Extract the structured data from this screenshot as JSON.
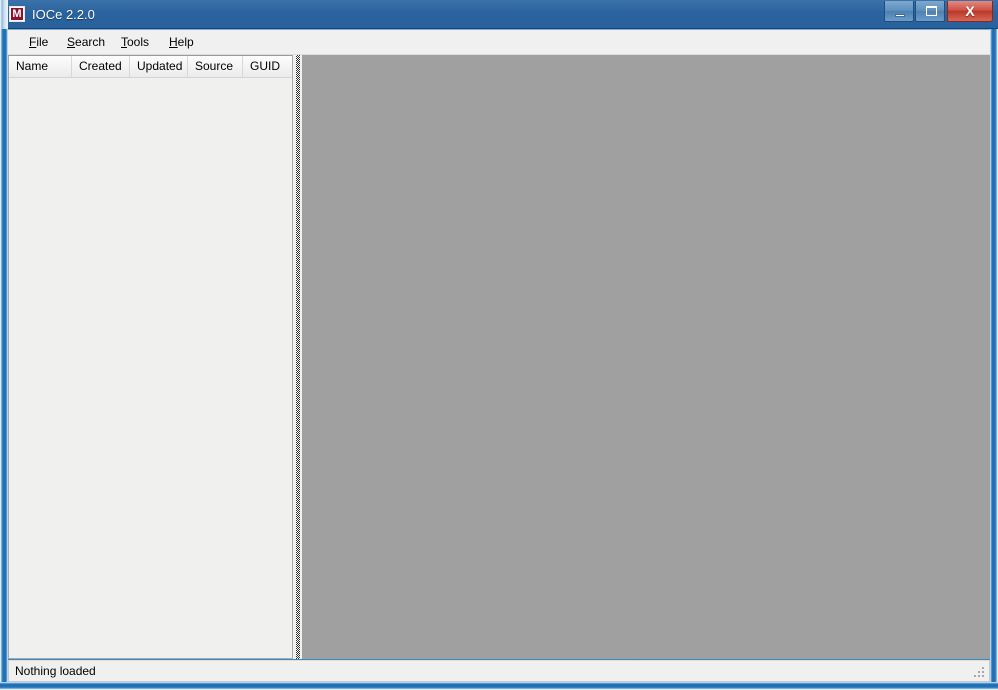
{
  "window": {
    "title": "IOCe 2.2.0",
    "icon": "ioc-editor-icon",
    "controls": {
      "minimize_label": "Minimize",
      "maximize_label": "Maximize",
      "close_label": "X"
    }
  },
  "menu": {
    "items": [
      {
        "label": "File",
        "accel": "F",
        "rest": "ile"
      },
      {
        "label": "Search",
        "accel": "S",
        "rest": "earch"
      },
      {
        "label": "Tools",
        "accel": "T",
        "rest": "ools"
      },
      {
        "label": "Help",
        "accel": "H",
        "rest": "elp"
      }
    ]
  },
  "list_panel": {
    "columns": [
      {
        "label": "Name"
      },
      {
        "label": "Created"
      },
      {
        "label": "Updated"
      },
      {
        "label": "Source"
      },
      {
        "label": "GUID"
      }
    ],
    "rows": []
  },
  "detail_panel": {
    "content": "",
    "background_color": "#a0a0a0"
  },
  "status_bar": {
    "text": "Nothing loaded",
    "grip": "resize-grip"
  },
  "colors": {
    "title_bar": "#2a639e",
    "frame_accent": "#2e7ebd",
    "close_button": "#bb3828",
    "client_background": "#f0f0ee",
    "detail_background": "#a0a0a0",
    "icon_red": "#8c1230"
  }
}
